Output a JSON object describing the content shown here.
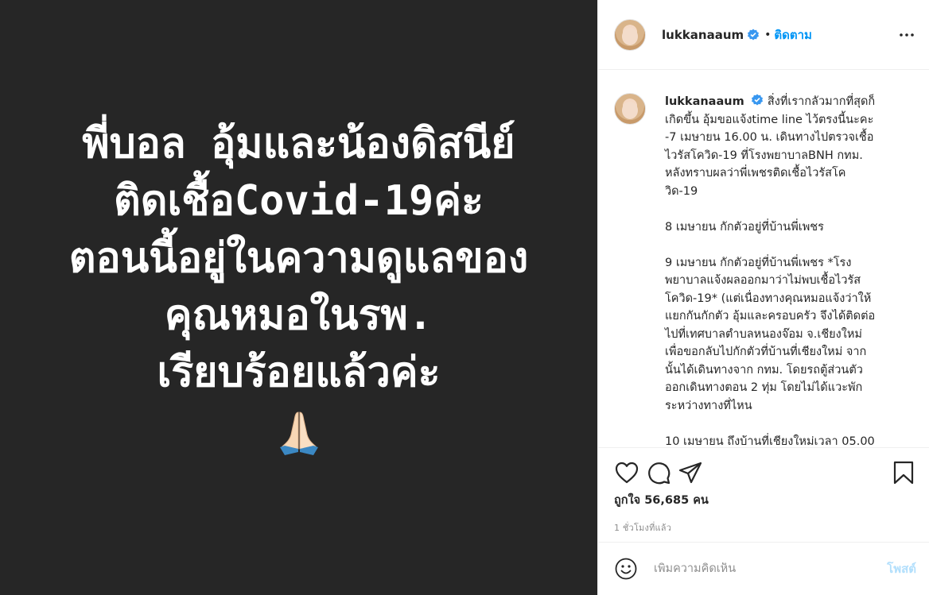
{
  "post": {
    "image_text_lines": [
      "พี่บอล อุ้มและน้องดิสนีย์",
      "ติดเชื้อCovid-19ค่ะ",
      "ตอนนี้อยู่ในความดูแลของ",
      "คุณหมอในรพ.",
      "เรียบร้อยแล้วค่ะ"
    ],
    "image_emoji": "praying-hands"
  },
  "header": {
    "username": "lukkanaaum",
    "separator": "•",
    "follow_label": "ติดตาม",
    "more_icon": "more-horizontal-icon"
  },
  "caption": {
    "username": "lukkanaaum",
    "lines": [
      "สิ่งที่เรากลัวมากที่สุดก็",
      "เกิดขึ้น อุ้มขอแจ้งtime line ไว้ตรงนี้นะคะ",
      "-7 เมษายน 16.00 น. เดินทางไปตรวจเชื้อ",
      "ไวรัสโควิด-19 ที่โรงพยาบาลBNH กทม.",
      "หลังทราบผลว่าพี่เพชรติดเชื้อไวรัสโค",
      "วิด-19",
      "",
      "8 เมษายน กักตัวอยู่ที่บ้านพี่เพชร",
      "",
      "9 เมษายน กักตัวอยู่ที่บ้านพี่เพชร *โรง",
      "พยาบาลแจ้งผลออกมาว่าไม่พบเชื้อไวรัส",
      "โควิด-19* (แต่เนื่องทางคุณหมอแจ้งว่าให้",
      "แยกกันกักตัว อุ้มและครอบครัว จึงได้ติดต่อ",
      "ไปที่เทศบาลตำบลหนองจ๊อม จ.เชียงใหม่",
      "เพื่อขอกลับไปกักตัวที่บ้านที่เชียงใหม่ จาก",
      "นั้นได้เดินทางจาก กทม. โดยรถตู้ส่วนตัว",
      "ออกเดินทางตอน 2 ทุ่ม โดยไม่ได้แวะพัก",
      "ระหว่างทางที่ไหน",
      "",
      "10 เมษายน ถึงบ้านที่เชียงใหม่เวลา 05.00"
    ]
  },
  "actions": {
    "like_icon": "heart-icon",
    "comment_icon": "comment-icon",
    "share_icon": "share-icon",
    "save_icon": "bookmark-icon",
    "likes_label": "ถูกใจ",
    "likes_count": "56,685",
    "likes_unit": "คน",
    "time_ago": "1 ชั่วโมงที่แล้ว"
  },
  "comment": {
    "emoji_icon": "smile-icon",
    "placeholder": "เพิ่มความคิดเห็น",
    "post_label": "โพสต์"
  },
  "colors": {
    "image_background": "#262626",
    "follow_blue": "#0095f6",
    "post_button_disabled": "#b2dffc",
    "secondary_text": "#8e8e8e"
  }
}
